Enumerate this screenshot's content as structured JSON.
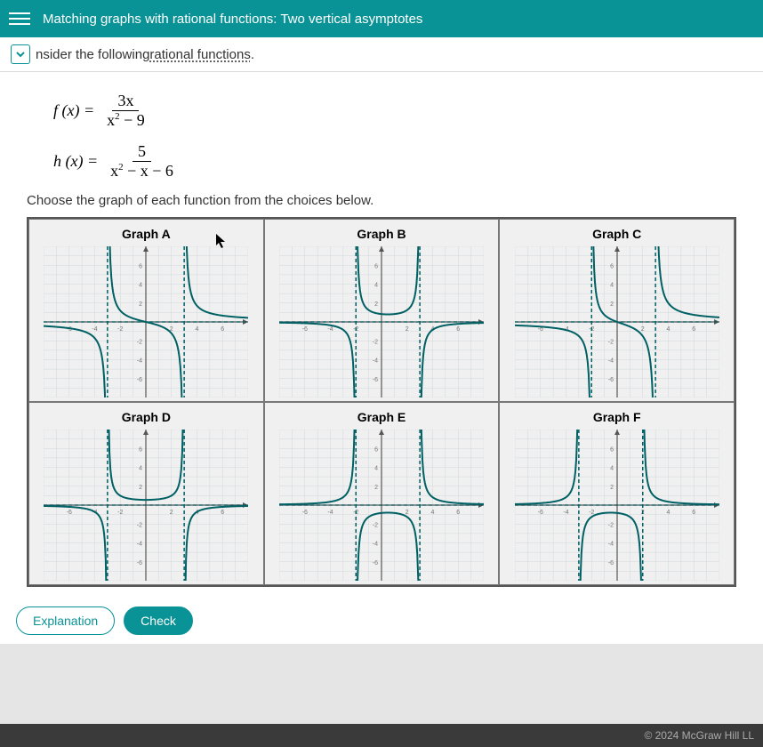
{
  "header": {
    "title": "Matching graphs with rational functions: Two vertical asymptotes"
  },
  "subheader": {
    "prefix": "nsider the following ",
    "link": "rational functions",
    "suffix": "."
  },
  "equations": {
    "f": {
      "lhs": "f (x) =",
      "num": "3x",
      "den_pre": "x",
      "den_post": " − 9"
    },
    "h": {
      "lhs": "h (x) =",
      "num": "5",
      "den_pre": "x",
      "den_post": " − x − 6"
    }
  },
  "instruction": "Choose the graph of each function from the choices below.",
  "graphs": {
    "a": "Graph A",
    "b": "Graph B",
    "c": "Graph C",
    "d": "Graph D",
    "e": "Graph E",
    "f": "Graph F"
  },
  "buttons": {
    "explanation": "Explanation",
    "check": "Check"
  },
  "footer": "© 2024 McGraw Hill LL",
  "chart_data": [
    {
      "id": "A",
      "type": "rational-plot",
      "xlim": [
        -8,
        8
      ],
      "ylim": [
        -8,
        8
      ],
      "v_asymptotes": [
        -3,
        3
      ],
      "h_asymptote": 0,
      "branches": "odd-symmetric"
    },
    {
      "id": "B",
      "type": "rational-plot",
      "xlim": [
        -8,
        8
      ],
      "ylim": [
        -8,
        8
      ],
      "v_asymptotes": [
        -2,
        3
      ],
      "h_asymptote": 0,
      "branches": "down-between"
    },
    {
      "id": "C",
      "type": "rational-plot",
      "xlim": [
        -8,
        8
      ],
      "ylim": [
        -8,
        8
      ],
      "v_asymptotes": [
        -2,
        3
      ],
      "h_asymptote": 0,
      "branches": "odd-shifted"
    },
    {
      "id": "D",
      "type": "rational-plot",
      "xlim": [
        -8,
        8
      ],
      "ylim": [
        -8,
        8
      ],
      "v_asymptotes": [
        -3,
        3
      ],
      "h_asymptote": 0,
      "branches": "down-between-sym"
    },
    {
      "id": "E",
      "type": "rational-plot",
      "xlim": [
        -8,
        8
      ],
      "ylim": [
        -8,
        8
      ],
      "v_asymptotes": [
        -2,
        3
      ],
      "h_asymptote": 0,
      "branches": "up-between"
    },
    {
      "id": "F",
      "type": "rational-plot",
      "xlim": [
        -8,
        8
      ],
      "ylim": [
        -8,
        8
      ],
      "v_asymptotes": [
        -3,
        2
      ],
      "h_asymptote": 0,
      "branches": "up-between"
    }
  ]
}
